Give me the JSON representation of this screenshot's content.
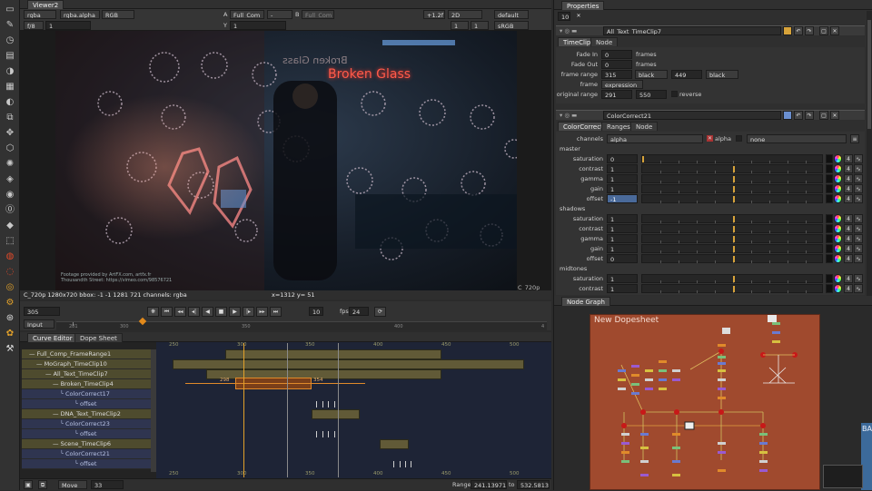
{
  "left_toolbar": {
    "icons": [
      "viewer-icon",
      "draw-icon",
      "time-icon",
      "channel-icon",
      "color-icon",
      "filter-icon",
      "keyer-icon",
      "merge-icon",
      "transform-icon",
      "3d-icon",
      "particles-icon",
      "deep-icon",
      "views-icon",
      "metadata-icon",
      "toolsets-icon",
      "other-icon",
      "furnace-icon",
      "ofx-icon",
      "cara-icon",
      "gear-icon",
      "mocha-icon",
      "plugin-icon",
      "python-icon"
    ]
  },
  "viewer": {
    "tab_title": "Viewer2",
    "toolbar": {
      "layer": "rgba",
      "channel": "rgba.alpha",
      "colorspace": "RGB",
      "input_a_label": "A",
      "input_a": "Full_Com",
      "compare": "-",
      "input_b_label": "B",
      "input_b": "Full_Com",
      "gain": "+1.2f",
      "view_mode": "2D",
      "lut": "default",
      "fstop": "f/8",
      "frame_one": "1",
      "y_label": "Y",
      "y_value": "1",
      "zoom": "1",
      "proxy": "1",
      "display": "sRGB"
    },
    "footer_credits": [
      "Footage provided by ArtFX.com, artfx.fr",
      "Thousandth Street: https://vimeo.com/98576721"
    ],
    "scene_text_main": "Broken Glass",
    "scene_text_mirror": "Broken Glass",
    "format_label": "C_720p",
    "status_line": "C_720p 1280x720 bbox: -1 -1 1281 721 channels: rgba",
    "coords": "x=1312 y=  51",
    "playback": {
      "frame": "305",
      "step": "10",
      "fps_label": "fps",
      "fps": "24",
      "input_mode": "Input",
      "ruler_ticks": [
        "281",
        "300",
        "350",
        "400",
        "4"
      ]
    }
  },
  "dopesheet": {
    "tabs": [
      "Curve Editor",
      "Dope Sheet"
    ],
    "ruler": [
      "250",
      "300",
      "350",
      "400",
      "450",
      "500"
    ],
    "tracks": [
      {
        "label": "Full_Comp_FrameRange1",
        "type": "main"
      },
      {
        "label": "MoGraph_TimeClip10",
        "type": "main"
      },
      {
        "label": "All_Text_TimeClip7",
        "type": "main"
      },
      {
        "label": "Broken_TimeClip4",
        "type": "main"
      },
      {
        "label": "ColorCorrect17",
        "type": "sub"
      },
      {
        "label": "offset",
        "type": "sub"
      },
      {
        "label": "DNA_Text_TimeClip2",
        "type": "main"
      },
      {
        "label": "ColorCorrect23",
        "type": "sub"
      },
      {
        "label": "offset",
        "type": "sub"
      },
      {
        "label": "Scene_TimeClip6",
        "type": "main"
      },
      {
        "label": "ColorCorrect21",
        "type": "sub"
      },
      {
        "label": "offset",
        "type": "sub"
      }
    ],
    "clip_range_start": "298",
    "clip_range_end": "354",
    "bottom": {
      "mode": "Move",
      "move_value": "33",
      "range_label": "Range",
      "range_start": "241.13971",
      "range_to": "to",
      "range_end": "532.58136"
    }
  },
  "properties": {
    "tab_title": "Properties",
    "max_panels": "10",
    "timeclip": {
      "node_name": "All_Text_TimeClip7",
      "tabs": [
        "TimeClip",
        "Node"
      ],
      "fade_in_label": "Fade In",
      "fade_in": "0",
      "fade_in_unit": "frames",
      "fade_out_label": "Fade Out",
      "fade_out": "0",
      "fade_out_unit": "frames",
      "frame_range_label": "frame range",
      "frame_range_start": "315",
      "frame_range_before": "black",
      "frame_range_end": "449",
      "frame_range_after": "black",
      "frame_label": "frame",
      "frame_mode": "expression",
      "original_range_label": "original range",
      "original_start": "291",
      "original_end": "550",
      "reverse_label": "reverse"
    },
    "colorcorrect": {
      "node_name": "ColorCorrect21",
      "tabs": [
        "ColorCorrect",
        "Ranges",
        "Node"
      ],
      "channels_label": "channels",
      "channels": "alpha",
      "alpha_label": "alpha",
      "second_channel": "none",
      "sections": [
        {
          "name": "master",
          "rows": [
            {
              "label": "saturation",
              "value": "0"
            },
            {
              "label": "contrast",
              "value": "1"
            },
            {
              "label": "gamma",
              "value": "1"
            },
            {
              "label": "gain",
              "value": "1"
            },
            {
              "label": "offset",
              "value": "-1",
              "highlight": true
            }
          ]
        },
        {
          "name": "shadows",
          "rows": [
            {
              "label": "saturation",
              "value": "1"
            },
            {
              "label": "contrast",
              "value": "1"
            },
            {
              "label": "gamma",
              "value": "1"
            },
            {
              "label": "gain",
              "value": "1"
            },
            {
              "label": "offset",
              "value": "0"
            }
          ]
        },
        {
          "name": "midtones",
          "rows": [
            {
              "label": "saturation",
              "value": "1"
            },
            {
              "label": "contrast",
              "value": "1"
            }
          ]
        }
      ],
      "row_count": "4"
    }
  },
  "node_graph": {
    "tab_title": "Node Graph",
    "backdrop_title": "New Dopesheet",
    "side_backdrop_title": "BA",
    "backdrop_color": "#a04a2e"
  },
  "colors": {
    "accent": "#d7a33a",
    "panel": "#2b2b2b",
    "track_main": "#615a37",
    "track_sub": "#2f3550"
  }
}
